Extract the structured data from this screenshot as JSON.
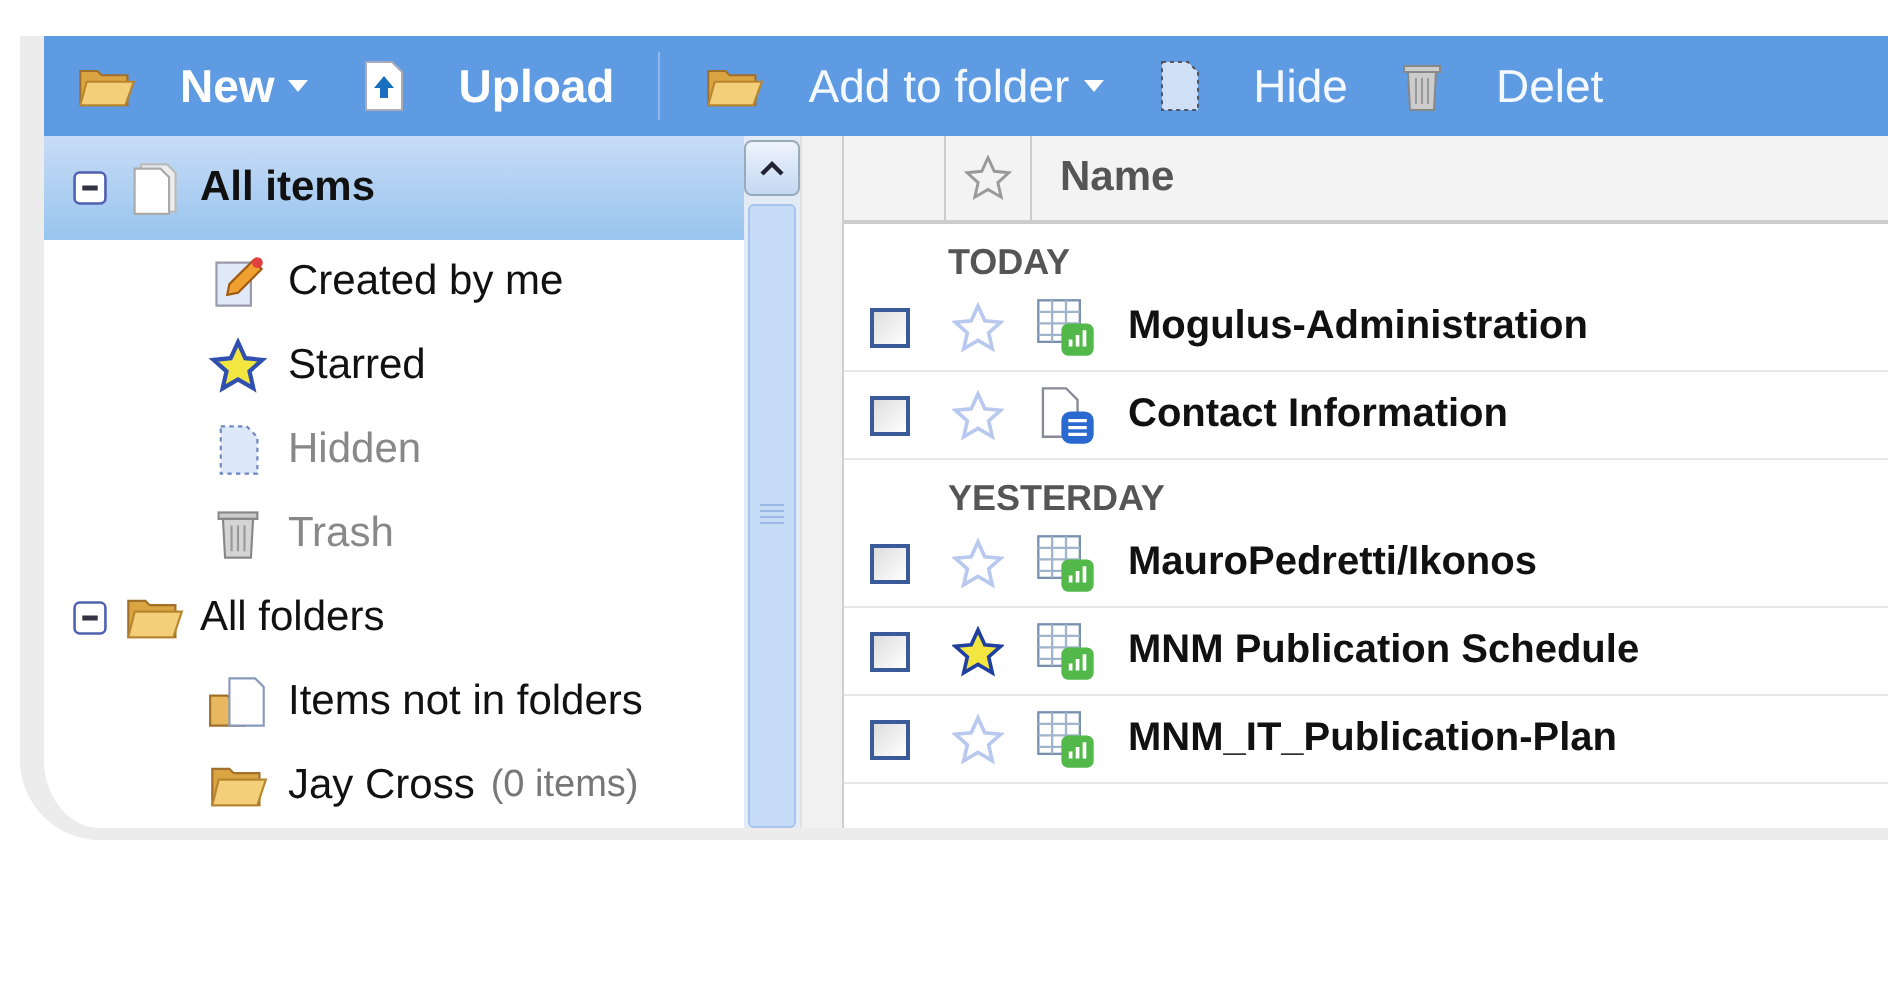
{
  "toolbar": [
    {
      "label": "New",
      "dropdown": true,
      "disabled": false
    },
    {
      "label": "Upload",
      "dropdown": false,
      "disabled": false
    },
    {
      "label": "Add to folder",
      "dropdown": true,
      "disabled": true
    },
    {
      "label": "Hide",
      "dropdown": false,
      "disabled": true
    },
    {
      "label": "Delet",
      "dropdown": false,
      "disabled": true
    }
  ],
  "sidebar": {
    "items": [
      {
        "label": "All items",
        "expanded": true,
        "selected": true,
        "children": [
          {
            "label": "Created by me",
            "muted": false
          },
          {
            "label": "Starred",
            "muted": false
          },
          {
            "label": "Hidden",
            "muted": true
          },
          {
            "label": "Trash",
            "muted": true
          }
        ]
      },
      {
        "label": "All folders",
        "expanded": true,
        "selected": false,
        "children": [
          {
            "label": "Items not in folders",
            "muted": false
          },
          {
            "label": "Jay Cross",
            "count": "(0 items)",
            "muted": false
          }
        ]
      }
    ]
  },
  "list": {
    "columns": [
      "Name"
    ],
    "groups": [
      {
        "label": "TODAY",
        "rows": [
          {
            "name": "Mogulus-Administration",
            "kind": "spreadsheet",
            "starred": false,
            "checked": false
          },
          {
            "name": "Contact Information",
            "kind": "document",
            "starred": false,
            "checked": false
          }
        ]
      },
      {
        "label": "YESTERDAY",
        "rows": [
          {
            "name": "MauroPedretti/Ikonos",
            "kind": "spreadsheet",
            "starred": false,
            "checked": false
          },
          {
            "name": "MNM Publication Schedule",
            "kind": "spreadsheet",
            "starred": true,
            "checked": false
          },
          {
            "name": "MNM_IT_Publication-Plan",
            "kind": "spreadsheet",
            "starred": false,
            "checked": false
          }
        ]
      }
    ]
  }
}
